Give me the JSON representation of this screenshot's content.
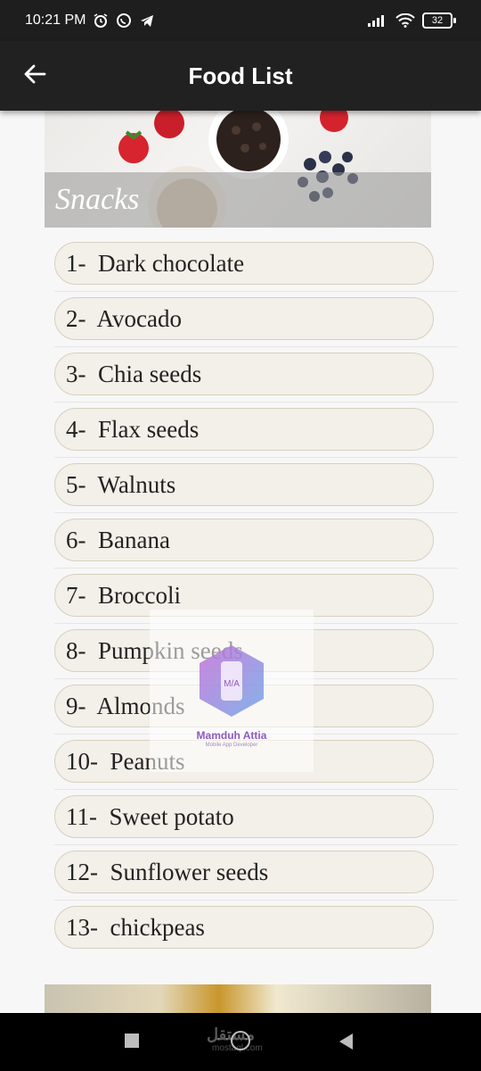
{
  "status_bar": {
    "time": "10:21 PM",
    "battery": "32",
    "icons": [
      "alarm-icon",
      "whatsapp-icon",
      "telegram-icon",
      "signal-icon",
      "wifi-icon",
      "battery-icon"
    ]
  },
  "app_bar": {
    "title": "Food List",
    "back_icon": "arrow-left-icon"
  },
  "banner": {
    "title": "Snacks"
  },
  "food_items": [
    "1-  Dark chocolate",
    "2-  Avocado",
    "3-  Chia seeds",
    "4-  Flax seeds",
    "5-  Walnuts",
    "6-  Banana",
    "7-  Broccoli",
    "8-  Pumpkin seeds",
    "9-  Almonds",
    "10-  Peanuts",
    "11-  Sweet potato",
    "12-  Sunflower seeds",
    "13-  chickpeas"
  ],
  "watermark": {
    "logo_text": "M/A",
    "name": "Mamduh Attia",
    "subtitle": "Mobile App Developer"
  },
  "nav_bar": {
    "watermark_text": "مستقل",
    "watermark_sub": "mostaql.com",
    "icons": [
      "recents-square-icon",
      "home-circle-icon",
      "back-triangle-icon"
    ]
  },
  "colors": {
    "app_bar": "#212121",
    "status_bar": "#1e1e1e",
    "pill_background": "#f3efe9",
    "pill_border": "#d7d0bd",
    "page_background": "#f7f7f8"
  }
}
